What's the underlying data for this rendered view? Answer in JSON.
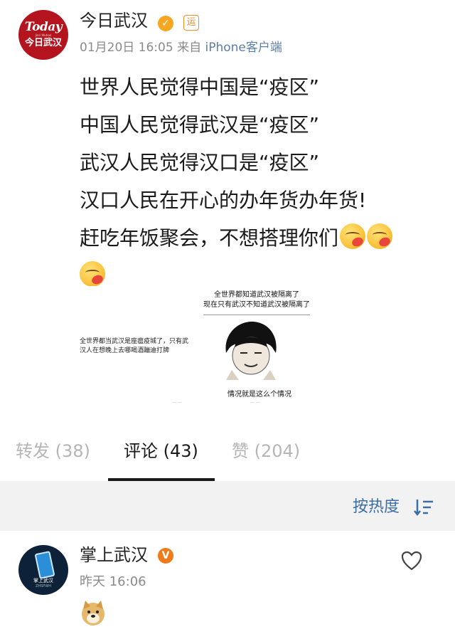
{
  "post": {
    "author": "今日武汉",
    "avatar": {
      "logo_top": "Today",
      "logo_sub": "Jinri Wuhan",
      "logo_cn": "今日武汉"
    },
    "verified_icon": "v-verified-icon",
    "tag_label": "运",
    "date": "01月20日 16:05",
    "source_prefix": "来自",
    "source": "iPhone客户端",
    "lines": [
      "世界人民觉得中国是“疫区”",
      "中国人民觉得武汉是“疫区”",
      "武汉人民觉得汉口是“疫区”",
      "汉口人民在开心的办年货办年货!",
      "赶吃年饭聚会，不想搭理你们"
    ],
    "emoji_name": "blowing-kiss-emoji"
  },
  "meme": {
    "left_text": "全世界都当武汉是座瘟疫城了，只有武汉人在想晚上去哪喝酒蹦迪打牌",
    "top_caption_1": "全世界都知道武汉被隔离了",
    "top_caption_2": "现在只有武汉不知道武汉被隔离了",
    "bottom_caption": "情况就是这么个情况"
  },
  "tabs": [
    {
      "label": "转发 (38)",
      "active": false
    },
    {
      "label": "评论 (43)",
      "active": true
    },
    {
      "label": "赞 (204)",
      "active": false
    }
  ],
  "sort": {
    "label": "按热度"
  },
  "comment": {
    "author": "掌上武汉",
    "avatar_text": "掌上武汉",
    "avatar_sub": "ZHSPWH",
    "time": "昨天 16:06",
    "colors": {
      "badge": "#f07a1a"
    }
  },
  "colors": {
    "link": "#3a6ea5",
    "verified": "#f5a623",
    "avatar_red": "#b3141d"
  }
}
